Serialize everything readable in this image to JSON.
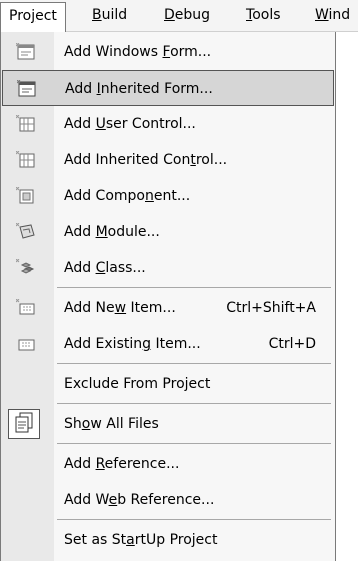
{
  "menubar": {
    "items": [
      {
        "pre": "Pro",
        "key": "j",
        "post": "ect"
      },
      {
        "pre": "",
        "key": "B",
        "post": "uild"
      },
      {
        "pre": "",
        "key": "D",
        "post": "ebug"
      },
      {
        "pre": "",
        "key": "T",
        "post": "ools"
      },
      {
        "pre": "",
        "key": "W",
        "post": "ind"
      }
    ]
  },
  "menu": {
    "items": [
      {
        "pre": "Add Windows ",
        "key": "F",
        "post": "orm..."
      },
      {
        "pre": "Add ",
        "key": "I",
        "post": "nherited Form..."
      },
      {
        "pre": "Add ",
        "key": "U",
        "post": "ser Control..."
      },
      {
        "pre": "Add Inherited Con",
        "key": "t",
        "post": "rol..."
      },
      {
        "pre": "Add Compo",
        "key": "n",
        "post": "ent..."
      },
      {
        "pre": "Add ",
        "key": "M",
        "post": "odule..."
      },
      {
        "pre": "Add ",
        "key": "C",
        "post": "lass..."
      },
      {
        "pre": "Add Ne",
        "key": "w",
        "post": " Item...",
        "shortcut": "Ctrl+Shift+A"
      },
      {
        "pre": "Add Existin",
        "key": "g",
        "post": " Item...",
        "shortcut": "Ctrl+D"
      },
      {
        "pre": "Exclude From Pro",
        "key": "j",
        "post": "ect"
      },
      {
        "pre": "Sh",
        "key": "o",
        "post": "w All Files"
      },
      {
        "pre": "Add ",
        "key": "R",
        "post": "eference..."
      },
      {
        "pre": "Add W",
        "key": "e",
        "post": "b Reference..."
      },
      {
        "pre": "Set as St",
        "key": "a",
        "post": "rtUp Project"
      }
    ]
  },
  "colors": {
    "highlight": "#d6d6d6",
    "gutter": "#e9e9e9",
    "menu_bg": "#f7f7f7"
  }
}
